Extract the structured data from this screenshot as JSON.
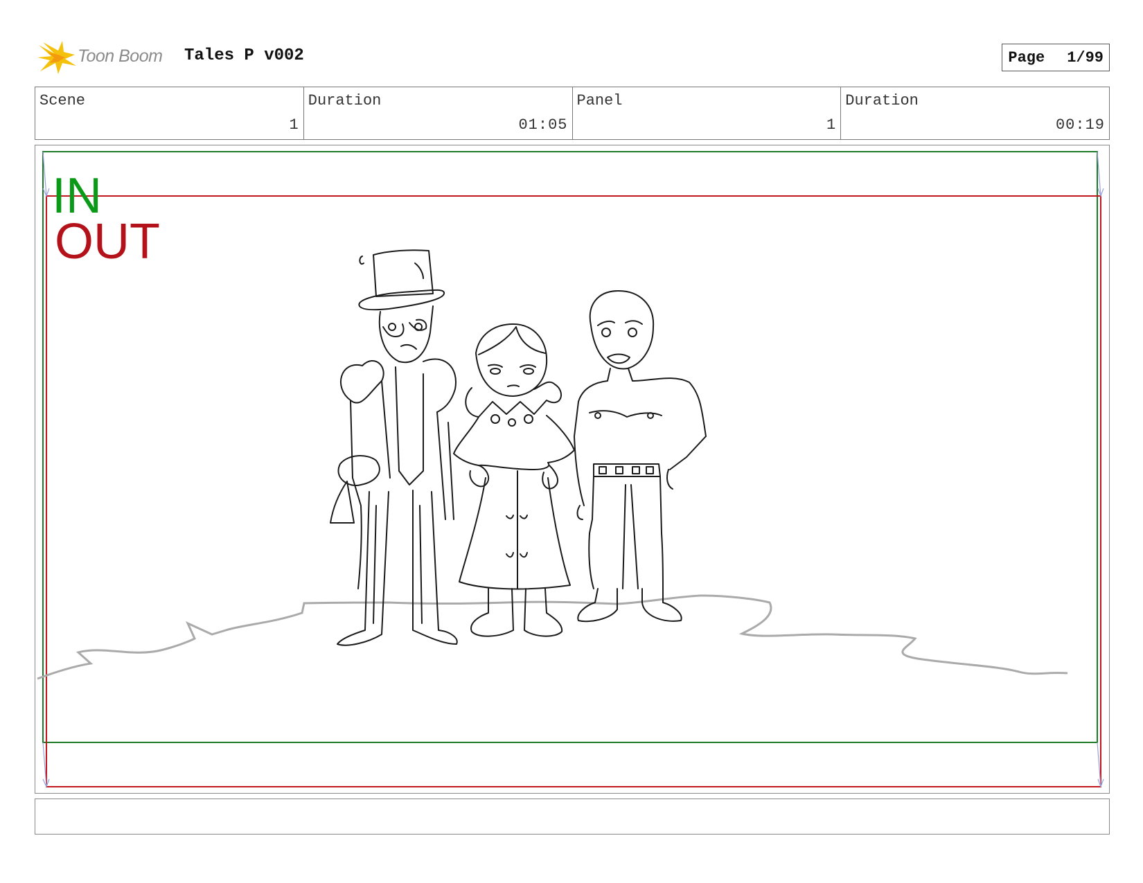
{
  "header": {
    "logo_text": "Toon Boom",
    "title": "Tales P v002",
    "page_label": "Page",
    "page_value": "1/99"
  },
  "info": {
    "scene_label": "Scene",
    "scene_value": "1",
    "scene_duration_label": "Duration",
    "scene_duration_value": "01:05",
    "panel_label": "Panel",
    "panel_value": "1",
    "panel_duration_label": "Duration",
    "panel_duration_value": "00:19"
  },
  "panel": {
    "in_label": "IN",
    "out_label": "OUT",
    "in_color": "#0a9a18",
    "out_color": "#b3121a"
  },
  "notes": {
    "text": ""
  }
}
